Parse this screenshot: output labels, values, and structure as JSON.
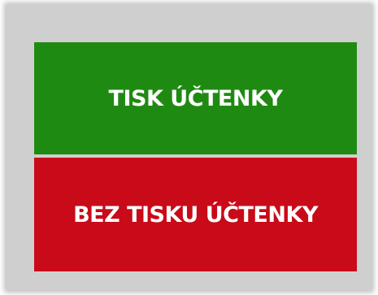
{
  "dialog": {
    "print_receipt_label": "TISK ÚČTENKY",
    "no_print_receipt_label": "BEZ TISKU ÚČTENKY"
  },
  "colors": {
    "print_button": "#1f8a12",
    "no_print_button": "#c90a18",
    "panel_background": "#cfcfcf",
    "text": "#ffffff"
  }
}
